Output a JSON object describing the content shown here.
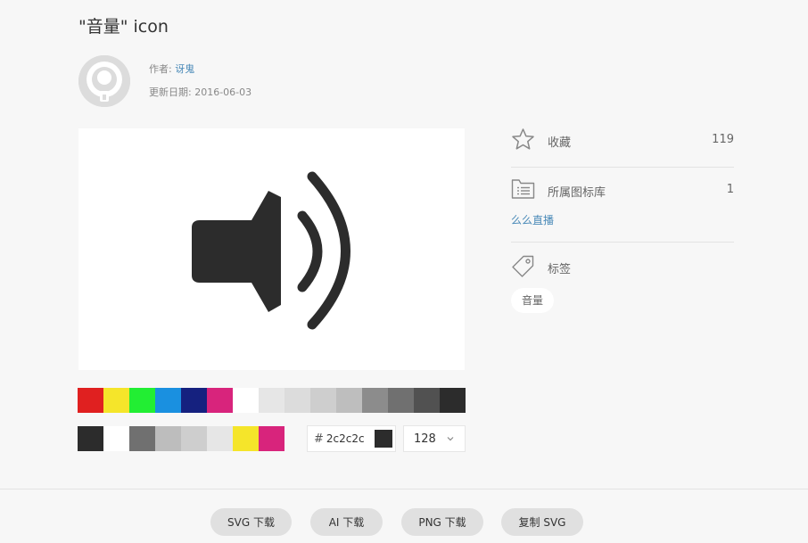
{
  "title": "\"音量\" icon",
  "author": {
    "label": "作者:",
    "name": "讶鬼"
  },
  "updated": {
    "label": "更新日期:",
    "date": "2016-06-03"
  },
  "palette_primary": [
    "#e02020",
    "#f5e52a",
    "#22ee33",
    "#1a90e0",
    "#15217f",
    "#d8247c",
    "#ffffff",
    "#e6e6e6",
    "#dcdcdc",
    "#cecece",
    "#bebebe",
    "#8c8c8c",
    "#707070",
    "#515151",
    "#2c2c2c"
  ],
  "palette_recent": [
    "#2c2c2c",
    "#ffffff",
    "#707070",
    "#bdbdbd",
    "#cecece",
    "#e6e6e6",
    "#f5e52a",
    "#d8247c"
  ],
  "color_input": {
    "hash": "#",
    "value": "2c2c2c",
    "swatch": "#2c2c2c"
  },
  "size_select": {
    "value": "128"
  },
  "sidebar": {
    "favorite": {
      "label": "收藏",
      "count": "119"
    },
    "library": {
      "label": "所属图标库",
      "count": "1",
      "link": "么么直播"
    },
    "tags": {
      "label": "标签",
      "items": [
        "音量"
      ]
    }
  },
  "buttons": {
    "svg": "SVG 下载",
    "ai": "AI 下载",
    "png": "PNG 下载",
    "copy": "复制 SVG"
  },
  "icon_color": "#2c2c2c"
}
